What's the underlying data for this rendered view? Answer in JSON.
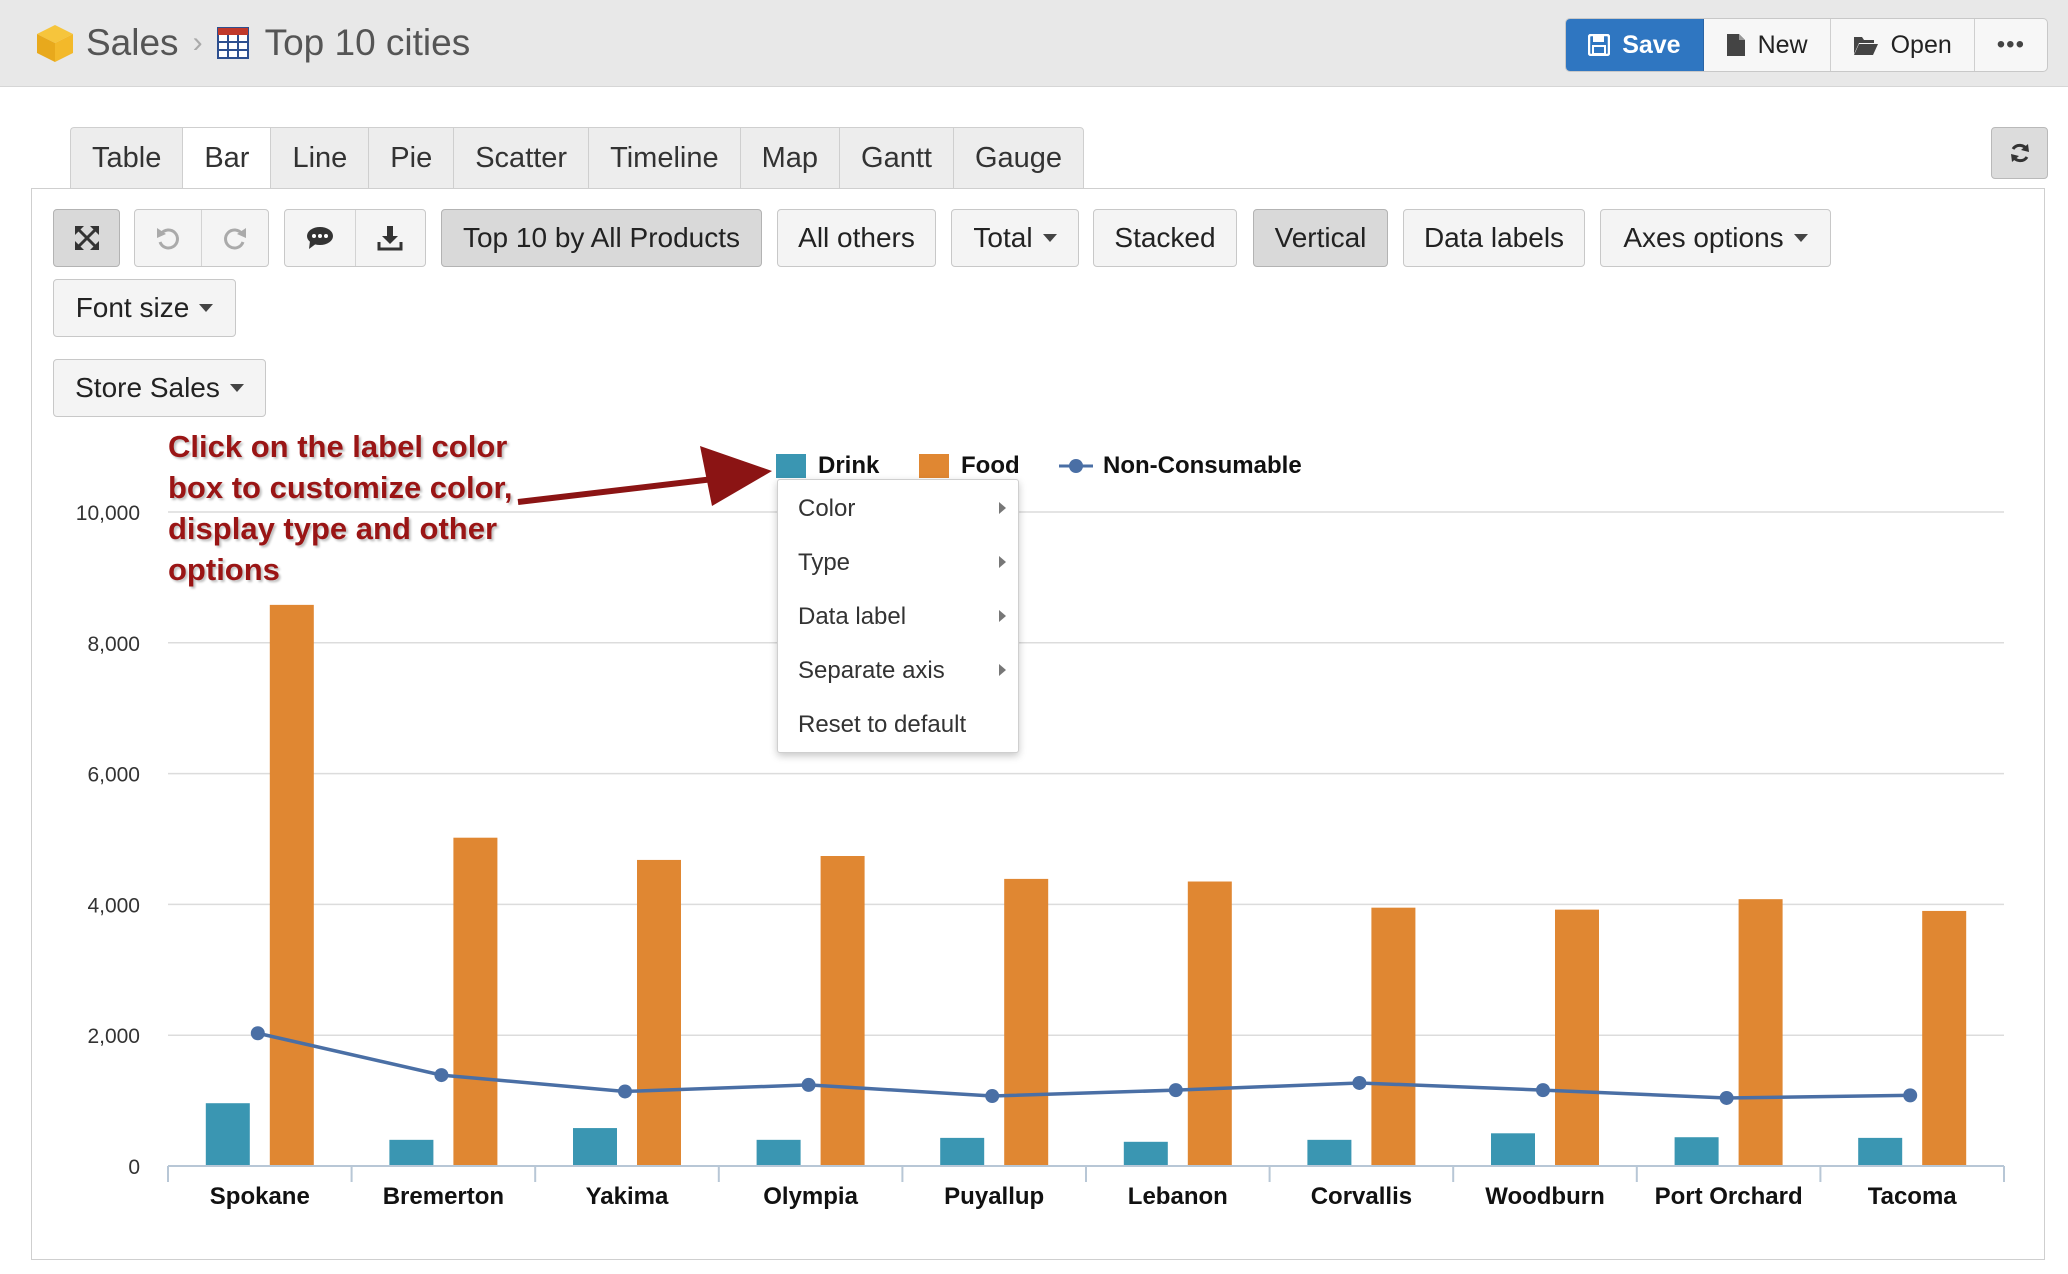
{
  "breadcrumb": {
    "app": "Sales",
    "report": "Top 10 cities"
  },
  "header_actions": {
    "save": "Save",
    "new": "New",
    "open": "Open",
    "more": "•••"
  },
  "tabs": [
    "Table",
    "Bar",
    "Line",
    "Pie",
    "Scatter",
    "Timeline",
    "Map",
    "Gantt",
    "Gauge"
  ],
  "active_tab": "Bar",
  "toolbar": {
    "top_by": "Top 10 by All Products",
    "all_others": "All others",
    "total": "Total",
    "stacked": "Stacked",
    "vertical": "Vertical",
    "data_labels": "Data labels",
    "axes_options": "Axes options",
    "font_size": "Font size",
    "measure": "Store Sales"
  },
  "annotation": [
    "Click on the label color",
    "box to customize color,",
    "display type and other",
    "options"
  ],
  "context_menu": [
    "Color",
    "Type",
    "Data label",
    "Separate axis",
    "Reset to default"
  ],
  "colors": {
    "drink": "#3a96b2",
    "food": "#e08732",
    "non_consumable": "#4a6fa5",
    "accent": "#2f76c1",
    "annotation": "#9a1515"
  },
  "chart_data": {
    "type": "bar",
    "categories": [
      "Spokane",
      "Bremerton",
      "Yakima",
      "Olympia",
      "Puyallup",
      "Lebanon",
      "Corvallis",
      "Woodburn",
      "Port Orchard",
      "Tacoma"
    ],
    "series": [
      {
        "name": "Drink",
        "type": "bar",
        "values": [
          960,
          400,
          580,
          400,
          430,
          370,
          400,
          500,
          440,
          430
        ]
      },
      {
        "name": "Food",
        "type": "bar",
        "values": [
          8580,
          5020,
          4680,
          4740,
          4390,
          4350,
          3950,
          3920,
          4080,
          3900
        ]
      },
      {
        "name": "Non-Consumable",
        "type": "line",
        "values": [
          2030,
          1390,
          1140,
          1240,
          1070,
          1160,
          1270,
          1160,
          1040,
          1080
        ]
      }
    ],
    "y_ticks": [
      "0",
      "2,000",
      "4,000",
      "6,000",
      "8,000",
      "10,000"
    ],
    "ylim": [
      0,
      10000
    ],
    "grid": true,
    "legend": "top"
  }
}
